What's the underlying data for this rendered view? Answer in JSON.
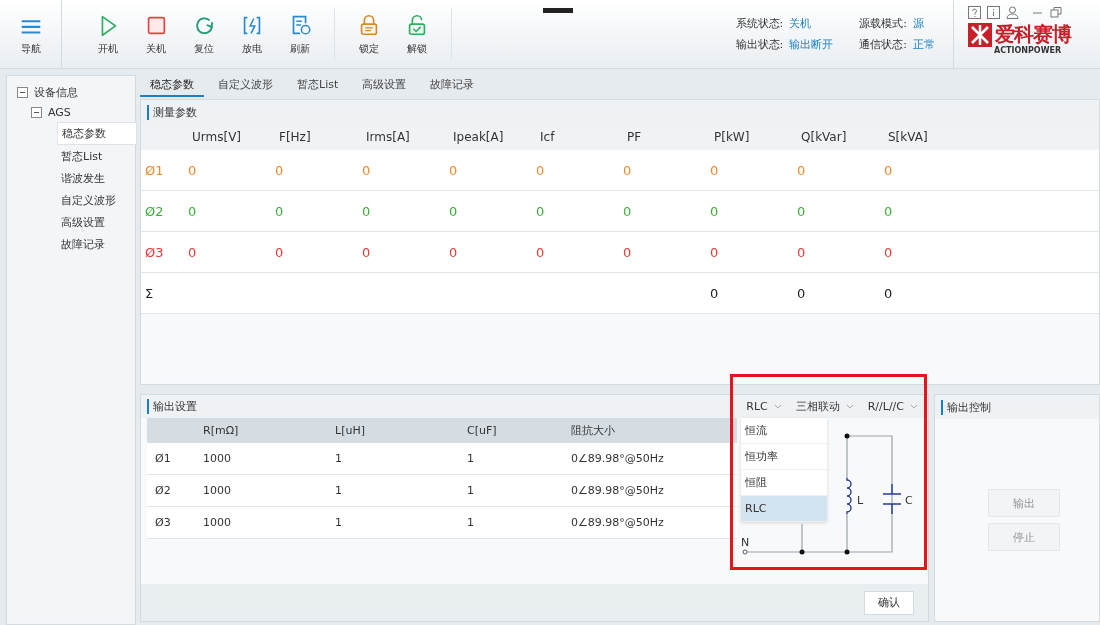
{
  "toolbar": {
    "nav": {
      "label": "导航"
    },
    "groups": [
      [
        {
          "label": "开机"
        },
        {
          "label": "关机"
        },
        {
          "label": "复位"
        },
        {
          "label": "放电"
        },
        {
          "label": "刷新"
        }
      ],
      [
        {
          "label": "锁定"
        },
        {
          "label": "解锁"
        }
      ]
    ]
  },
  "status": [
    {
      "label": "系统状态:",
      "value": "关机"
    },
    {
      "label": "源载模式:",
      "value": "源"
    },
    {
      "label": "输出状态:",
      "value": "输出断开"
    },
    {
      "label": "通信状态:",
      "value": "正常"
    }
  ],
  "logo": {
    "name": "爱科赛博",
    "subtitle": "ACTIONPOWER"
  },
  "sidebar": {
    "items": [
      {
        "label": "设备信息",
        "expanded": true,
        "children": [
          {
            "label": "AGS",
            "expanded": true,
            "children": [
              {
                "label": "稳态参数",
                "selected": true
              },
              {
                "label": "暂态List",
                "selected": false
              },
              {
                "label": "谐波发生",
                "selected": false
              },
              {
                "label": "自定义波形",
                "selected": false
              },
              {
                "label": "高级设置",
                "selected": false
              },
              {
                "label": "故障记录",
                "selected": false
              }
            ]
          }
        ]
      }
    ]
  },
  "tabs": [
    {
      "label": "稳态参数",
      "selected": true
    },
    {
      "label": "自定义波形",
      "selected": false
    },
    {
      "label": "暂态List",
      "selected": false
    },
    {
      "label": "高级设置",
      "selected": false
    },
    {
      "label": "故障记录",
      "selected": false
    }
  ],
  "measurement": {
    "title": "测量参数",
    "columns": [
      "",
      "Urms[V]",
      "F[Hz]",
      "Irms[A]",
      "Ipeak[A]",
      "Icf",
      "PF",
      "P[kW]",
      "Q[kVar]",
      "S[kVA]"
    ],
    "rows": [
      {
        "label": "Ø1",
        "color": "#f0892c",
        "cells": [
          "0",
          "0",
          "0",
          "0",
          "0",
          "0",
          "0",
          "0",
          "0"
        ]
      },
      {
        "label": "Ø2",
        "color": "#3dae3a",
        "cells": [
          "0",
          "0",
          "0",
          "0",
          "0",
          "0",
          "0",
          "0",
          "0"
        ]
      },
      {
        "label": "Ø3",
        "color": "#e53b35",
        "cells": [
          "0",
          "0",
          "0",
          "0",
          "0",
          "0",
          "0",
          "0",
          "0"
        ]
      },
      {
        "label": "Σ",
        "color": "#222222",
        "cells": [
          "",
          "",
          "",
          "",
          "",
          "",
          "0",
          "0",
          "0"
        ]
      }
    ]
  },
  "output": {
    "title": "输出设置",
    "selects": [
      "RLC",
      "三相联动",
      "R//L//C"
    ],
    "columns": [
      "",
      "R[mΩ]",
      "L[uH]",
      "C[uF]",
      "阻抗大小"
    ],
    "rows": [
      [
        "Ø1",
        "1000",
        "1",
        "1",
        "0∠89.98°@50Hz"
      ],
      [
        "Ø2",
        "1000",
        "1",
        "1",
        "0∠89.98°@50Hz"
      ],
      [
        "Ø3",
        "1000",
        "1",
        "1",
        "0∠89.98°@50Hz"
      ]
    ],
    "dropdown": [
      {
        "label": "恒流",
        "selected": false
      },
      {
        "label": "恒功率",
        "selected": false
      },
      {
        "label": "恒阻",
        "selected": false
      },
      {
        "label": "RLC",
        "selected": true
      }
    ],
    "circuit": {
      "labels": [
        "L",
        "C",
        "N"
      ]
    },
    "confirm": "确认"
  },
  "control": {
    "title": "输出控制",
    "buttons": [
      {
        "label": "输出",
        "disabled": true
      },
      {
        "label": "停止",
        "disabled": true
      }
    ]
  }
}
